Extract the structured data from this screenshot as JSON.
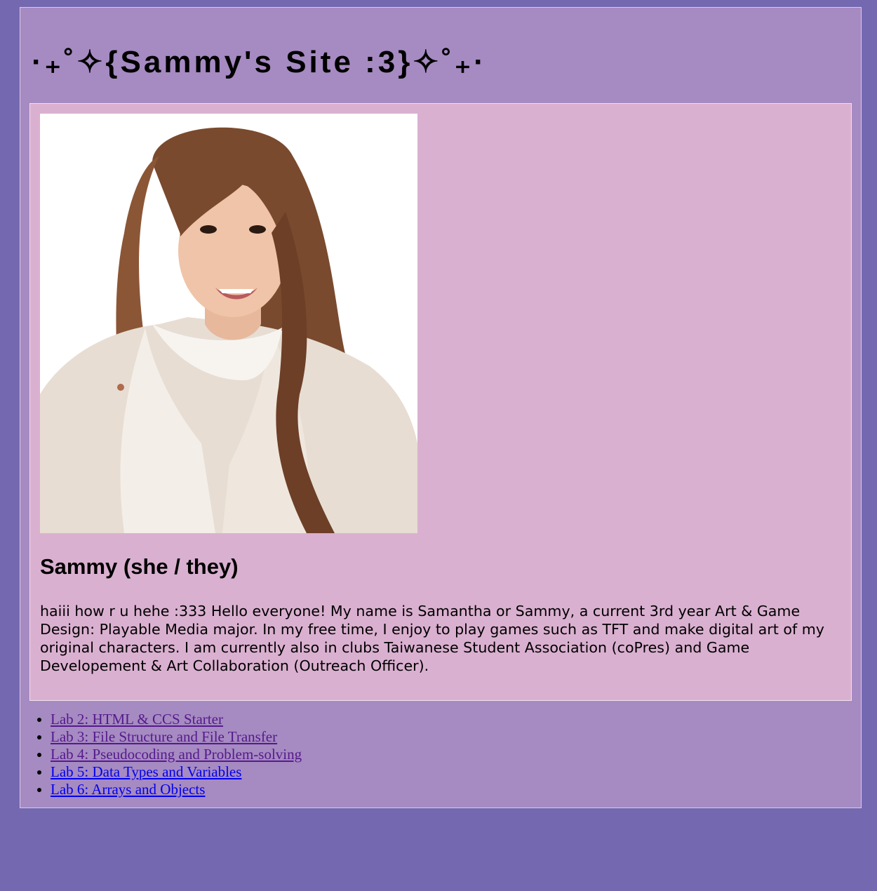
{
  "header": {
    "title": "·₊˚✧{Sammy's Site :3}✧˚₊·"
  },
  "profile": {
    "photo_alt": "",
    "name": "Sammy (she / they)",
    "bio": "haiii how r u hehe :333 Hello everyone! My name is Samantha or Sammy, a current 3rd year Art & Game Design: Playable Media major. In my free time, I enjoy to play games such as TFT and make digital art of my original characters. I am currently also in clubs Taiwanese Student Association (coPres) and Game Developement & Art Collaboration (Outreach Officer)."
  },
  "labs": [
    {
      "label": "Lab 2: HTML & CCS Starter",
      "state": "visited"
    },
    {
      "label": "Lab 3: File Structure and File Transfer",
      "state": "visited"
    },
    {
      "label": "Lab 4: Pseudocoding and Problem-solving",
      "state": "visited"
    },
    {
      "label": "Lab 5: Data Types and Variables",
      "state": "unvisited"
    },
    {
      "label": "Lab 6: Arrays and Objects",
      "state": "unvisited"
    }
  ],
  "colors": {
    "page_background": "#7469b0",
    "container_background": "#a68ac2",
    "card_background": "#dab0d0",
    "visited_link": "#551a8b",
    "unvisited_link": "#0000ee"
  }
}
